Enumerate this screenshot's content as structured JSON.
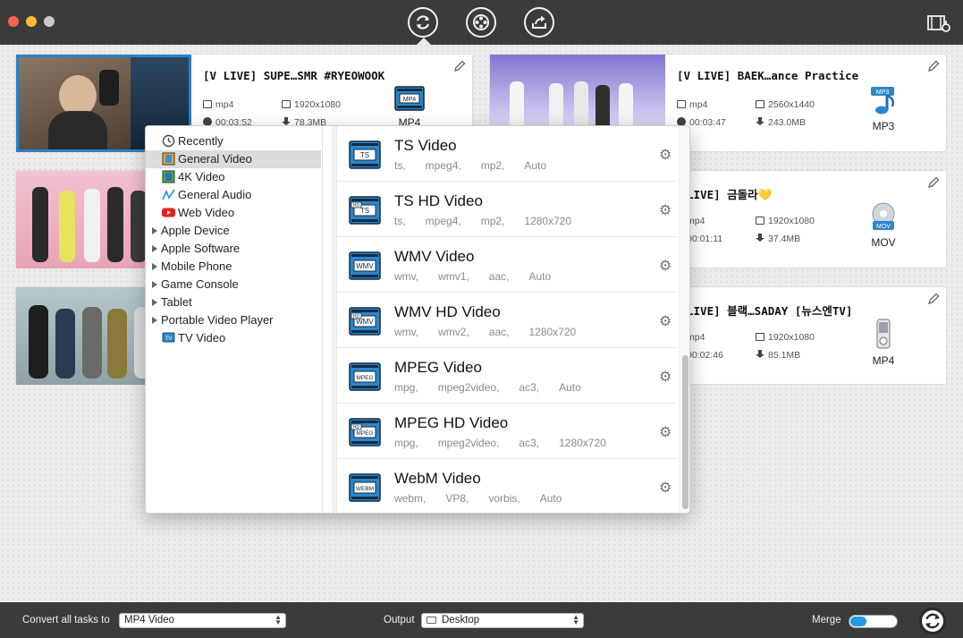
{
  "titlebar": {
    "buttons": [
      {
        "name": "convert-icon"
      },
      {
        "name": "film-reel-icon"
      },
      {
        "name": "share-icon"
      }
    ],
    "right_icon": "media-settings-icon"
  },
  "tasks": [
    {
      "title": "[V LIVE] SUPE…SMR #RYEOWOOK",
      "container": "mp4",
      "resolution": "1920x1080",
      "duration": "00:03:52",
      "size": "78.3MB",
      "output_format": "MP4",
      "output_badge": "MP4",
      "thumb_colors": [
        "#6b5848",
        "#23394f"
      ]
    },
    {
      "title": "[V LIVE] BAEK…ance Practice",
      "container": "mp4",
      "resolution": "2560x1440",
      "duration": "00:03:47",
      "size": "243.0MB",
      "output_format": "MP3",
      "output_badge": "MP3",
      "thumb_colors": [
        "#8a80d6",
        "#d9d0f3"
      ]
    },
    {
      "title": "[V LIVE] 금돌라💛",
      "container": "mp4",
      "resolution": "1920x1080",
      "duration": "00:01:11",
      "size": "37.4MB",
      "output_format": "MOV",
      "output_badge": "MOV",
      "thumb_colors": [
        "#e8a8b8",
        "#f3d6de"
      ]
    },
    {
      "title": "[V LIVE] 블랙…SADAY [뉴스엔TV]",
      "container": "mp4",
      "resolution": "1920x1080",
      "duration": "00:02:46",
      "size": "85.1MB",
      "output_format": "MP4",
      "output_badge": "",
      "thumb_colors": [
        "#9ab0b5",
        "#5b6e74"
      ]
    }
  ],
  "visible_title_fragments": {
    "t3": "LIVE] 금돌라💛",
    "t4": "LIVE] 블랙…SADAY [뉴스엔TV]",
    "t3_container": "mp4",
    "t3_duration": "00:01:11",
    "t4_container": "mp4",
    "t4_duration": "00:02:46",
    "t1_format_label": "MP4"
  },
  "popup": {
    "categories": [
      {
        "label": "Recently",
        "icon": "clock-icon",
        "expandable": false,
        "active": false
      },
      {
        "label": "General Video",
        "icon": "film-icon",
        "expandable": false,
        "active": true
      },
      {
        "label": "4K Video",
        "icon": "4k-film-icon",
        "expandable": false,
        "active": false
      },
      {
        "label": "General Audio",
        "icon": "audio-wave-icon",
        "expandable": false,
        "active": false
      },
      {
        "label": "Web Video",
        "icon": "youtube-icon",
        "expandable": false,
        "active": false
      },
      {
        "label": "Apple Device",
        "icon": "",
        "expandable": true,
        "active": false
      },
      {
        "label": "Apple Software",
        "icon": "",
        "expandable": true,
        "active": false
      },
      {
        "label": "Mobile Phone",
        "icon": "",
        "expandable": true,
        "active": false
      },
      {
        "label": "Game Console",
        "icon": "",
        "expandable": true,
        "active": false
      },
      {
        "label": "Tablet",
        "icon": "",
        "expandable": true,
        "active": false
      },
      {
        "label": "Portable Video Player",
        "icon": "",
        "expandable": true,
        "active": false
      },
      {
        "label": "TV Video",
        "icon": "tv-icon",
        "expandable": false,
        "active": false
      }
    ],
    "formats": [
      {
        "name": "TS Video",
        "badge": "TS",
        "hd": false,
        "specs": [
          "ts,",
          "mpeg4,",
          "mp2,",
          "Auto"
        ]
      },
      {
        "name": "TS HD Video",
        "badge": "TS",
        "hd": true,
        "specs": [
          "ts,",
          "mpeg4,",
          "mp2,",
          "1280x720"
        ]
      },
      {
        "name": "WMV Video",
        "badge": "WMV",
        "hd": false,
        "specs": [
          "wmv,",
          "wmv1,",
          "aac,",
          "Auto"
        ]
      },
      {
        "name": "WMV HD Video",
        "badge": "WMV",
        "hd": true,
        "specs": [
          "wmv,",
          "wmv2,",
          "aac,",
          "1280x720"
        ]
      },
      {
        "name": "MPEG Video",
        "badge": "MPEG",
        "hd": false,
        "specs": [
          "mpg,",
          "mpeg2video,",
          "ac3,",
          "Auto"
        ]
      },
      {
        "name": "MPEG HD Video",
        "badge": "MPEG",
        "hd": true,
        "specs": [
          "mpg,",
          "mpeg2video,",
          "ac3,",
          "1280x720"
        ]
      },
      {
        "name": "WebM Video",
        "badge": "WEBM",
        "hd": false,
        "specs": [
          "webm,",
          "VP8,",
          "vorbis,",
          "Auto"
        ]
      }
    ]
  },
  "bottombar": {
    "convert_all_label": "Convert all tasks to",
    "convert_all_value": "MP4 Video",
    "output_label": "Output",
    "output_value": "Desktop",
    "merge_label": "Merge"
  }
}
